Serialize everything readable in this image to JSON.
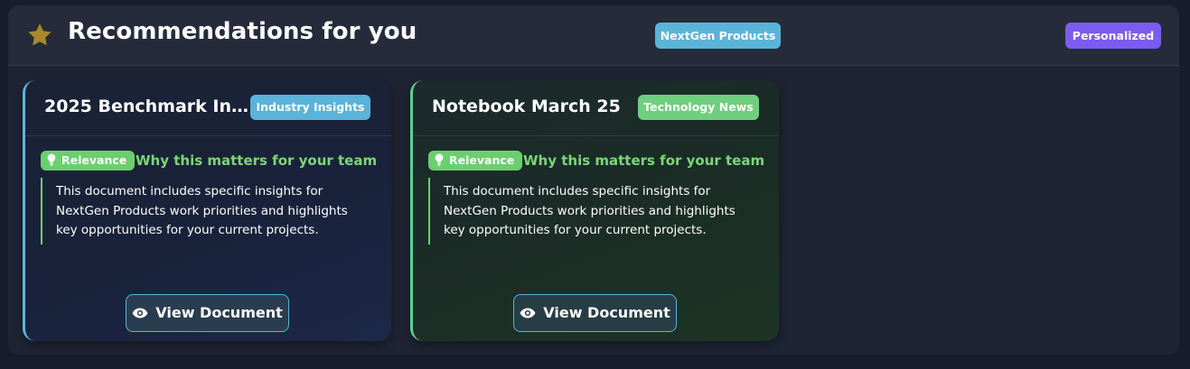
{
  "header": {
    "title": "Recommendations for you",
    "team_badge": "NextGen Products",
    "personal_badge": "Personalized",
    "icon": "star-icon",
    "accent": "#b08d2a"
  },
  "cards": [
    {
      "title": "2025 Benchmark Insig...",
      "tag": "Industry Insights",
      "tag_color": "#5ab3d8",
      "relevance_label": "Relevance",
      "why_heading": "Why this matters for your team",
      "description": "This document includes specific insights for NextGen Products work priorities and highlights key opportunities for your current projects.",
      "button_label": "View Document"
    },
    {
      "title": "Notebook March 25",
      "tag": "Technology News",
      "tag_color": "#6fcf7e",
      "relevance_label": "Relevance",
      "why_heading": "Why this matters for your team",
      "description": "This document includes specific insights for NextGen Products work priorities and highlights key opportunities for your current projects.",
      "button_label": "View Document"
    }
  ]
}
